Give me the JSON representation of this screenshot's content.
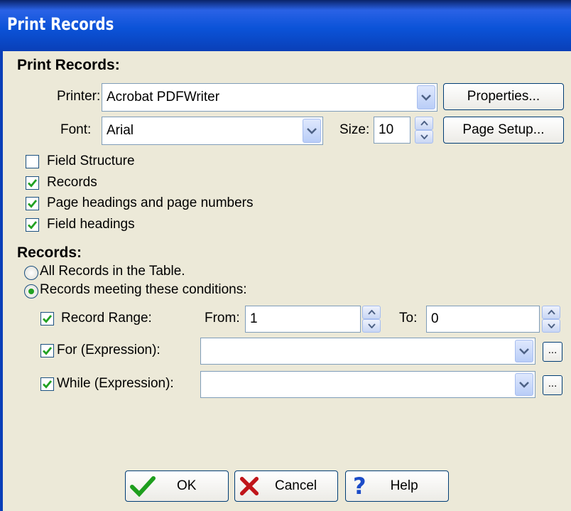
{
  "window": {
    "title": "Print Records"
  },
  "print_section": {
    "heading": "Print Records:",
    "printer_label": "Printer:",
    "printer_value": "Acrobat PDFWriter",
    "properties_button": "Properties...",
    "font_label": "Font:",
    "font_value": "Arial",
    "size_label": "Size:",
    "size_value": "10",
    "page_setup_button": "Page Setup..."
  },
  "options": [
    {
      "label": "Field Structure",
      "checked": false
    },
    {
      "label": "Records",
      "checked": true
    },
    {
      "label": "Page headings and page numbers",
      "checked": true
    },
    {
      "label": "Field headings",
      "checked": true
    }
  ],
  "records_section": {
    "heading": "Records:",
    "radio_all": "All Records in the Table.",
    "radio_conditions": "Records meeting these conditions:",
    "selected": "conditions",
    "record_range_label": "Record Range:",
    "record_range_checked": true,
    "from_label": "From:",
    "from_value": "1",
    "to_label": "To:",
    "to_value": "0",
    "for_label": "For (Expression):",
    "for_checked": true,
    "for_value": "",
    "while_label": "While (Expression):",
    "while_checked": true,
    "while_value": "",
    "ellipsis": "..."
  },
  "buttons": {
    "ok": "OK",
    "cancel": "Cancel",
    "help": "Help"
  },
  "colors": {
    "title_bar": "#0b53d8",
    "dialog_bg": "#ece9d8",
    "check_mark": "#21a121",
    "ok_icon": "#1e9e1e",
    "cancel_icon": "#c0151a",
    "help_icon": "#1c4cc8"
  }
}
